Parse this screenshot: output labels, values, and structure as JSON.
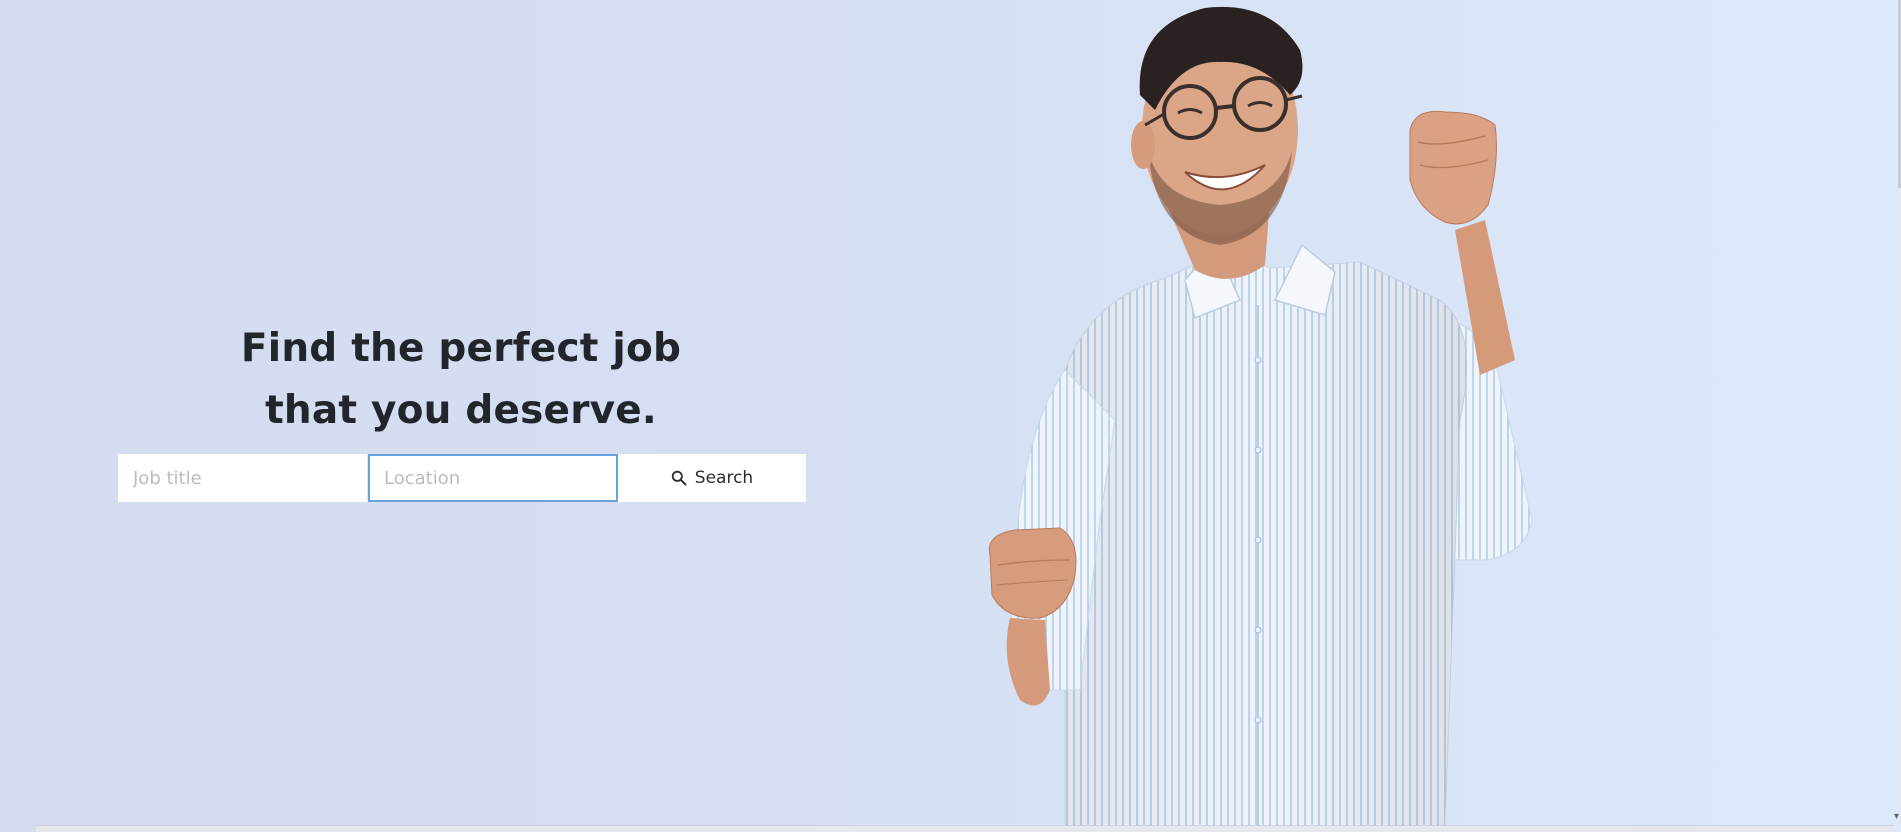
{
  "hero": {
    "headline_line1": "Find the perfect job",
    "headline_line2": "that you deserve."
  },
  "search": {
    "job_placeholder": "Job title",
    "location_placeholder": "Location",
    "button_label": "Search",
    "button_icon": "search-icon"
  },
  "image": {
    "subject": "smiling-man-celebrating"
  },
  "colors": {
    "background": "#d6e0f3",
    "headline": "#22252b",
    "focus_border": "#6aa3db"
  }
}
